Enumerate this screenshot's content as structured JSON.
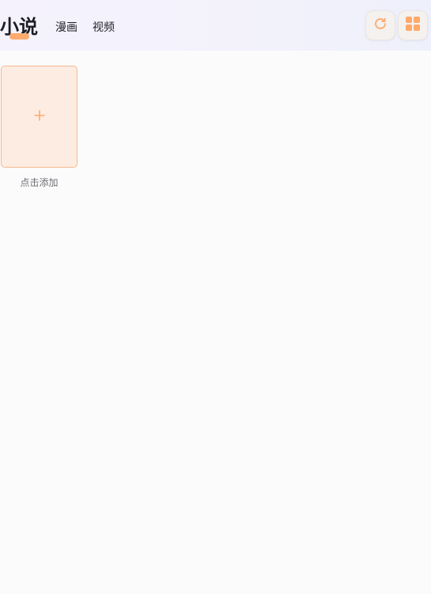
{
  "header": {
    "tabs": [
      {
        "label": "小说",
        "active": true
      },
      {
        "label": "漫画",
        "active": false
      },
      {
        "label": "视频",
        "active": false
      }
    ],
    "actions": [
      {
        "name": "refresh",
        "icon": "refresh-icon"
      },
      {
        "name": "grid-view",
        "icon": "grid-icon"
      }
    ]
  },
  "library": {
    "add_card": {
      "icon": "plus-icon",
      "label": "点击添加"
    }
  },
  "colors": {
    "accent": "#ffab6e",
    "card_bg": "#fdece2",
    "card_border": "#f7b98c"
  }
}
